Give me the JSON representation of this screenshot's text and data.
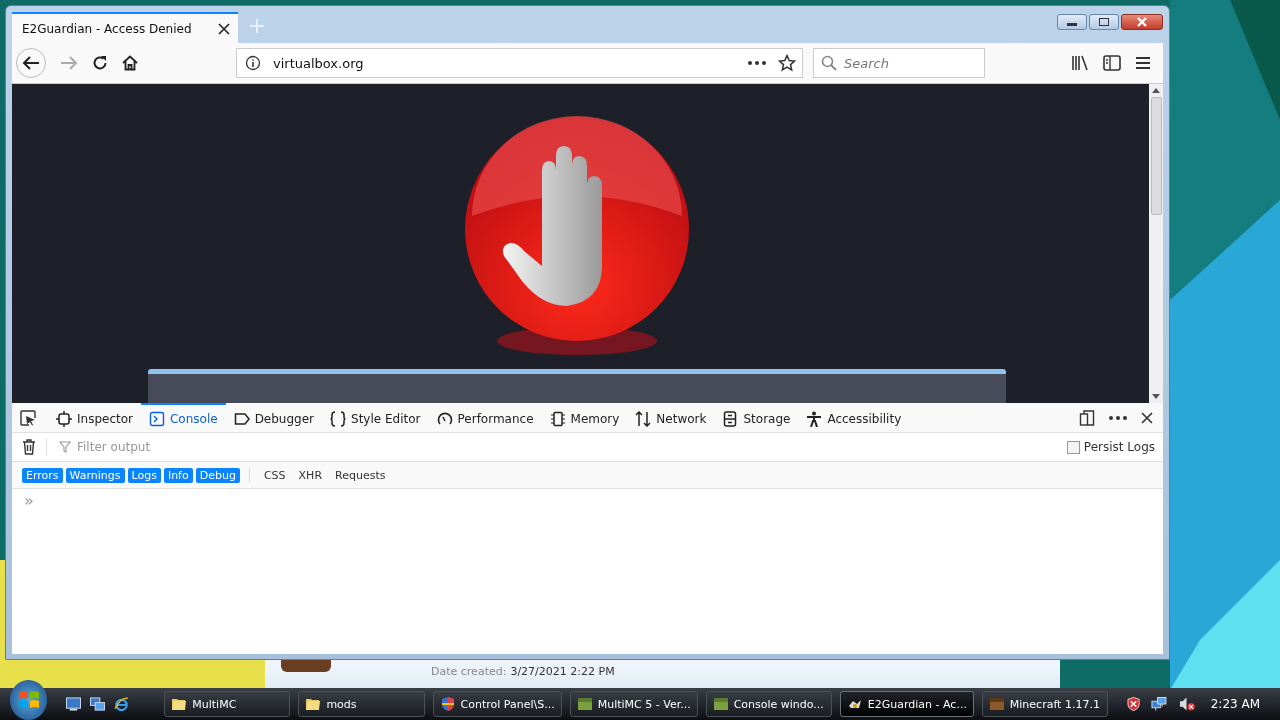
{
  "browser": {
    "tabs": [
      {
        "title": "E2Guardian - Access Denied",
        "selected": true
      }
    ],
    "url": "virtualbox.org",
    "search": {
      "placeholder": "Search"
    }
  },
  "devtools": {
    "tabs": [
      {
        "label": "Inspector",
        "selected": false
      },
      {
        "label": "Console",
        "selected": true
      },
      {
        "label": "Debugger",
        "selected": false
      },
      {
        "label": "Style Editor",
        "selected": false
      },
      {
        "label": "Performance",
        "selected": false
      },
      {
        "label": "Memory",
        "selected": false
      },
      {
        "label": "Network",
        "selected": false
      },
      {
        "label": "Storage",
        "selected": false
      },
      {
        "label": "Accessibility",
        "selected": false
      }
    ],
    "filter": {
      "placeholder": "Filter output"
    },
    "persist_logs": {
      "label": "Persist Logs",
      "checked": false
    },
    "level_filters": [
      {
        "label": "Errors",
        "on": true
      },
      {
        "label": "Warnings",
        "on": true
      },
      {
        "label": "Logs",
        "on": true
      },
      {
        "label": "Info",
        "on": true
      },
      {
        "label": "Debug",
        "on": true
      }
    ],
    "type_filters": [
      {
        "label": "CSS",
        "on": false
      },
      {
        "label": "XHR",
        "on": false
      },
      {
        "label": "Requests",
        "on": false
      }
    ],
    "prompt": "»"
  },
  "explorer": {
    "label": "Date created:",
    "value": "3/27/2021 2:22 PM"
  },
  "taskbar": {
    "items": [
      {
        "label": "MultiMC",
        "selected": false
      },
      {
        "label": "mods",
        "selected": false
      },
      {
        "label": "Control Panel\\S...",
        "selected": false
      },
      {
        "label": "MultiMC 5 - Ver...",
        "selected": false
      },
      {
        "label": "Console windo...",
        "selected": false
      },
      {
        "label": "E2Guardian - Ac...",
        "selected": true
      },
      {
        "label": "Minecraft 1.17.1",
        "selected": false
      }
    ],
    "clock": "2:23 AM"
  }
}
